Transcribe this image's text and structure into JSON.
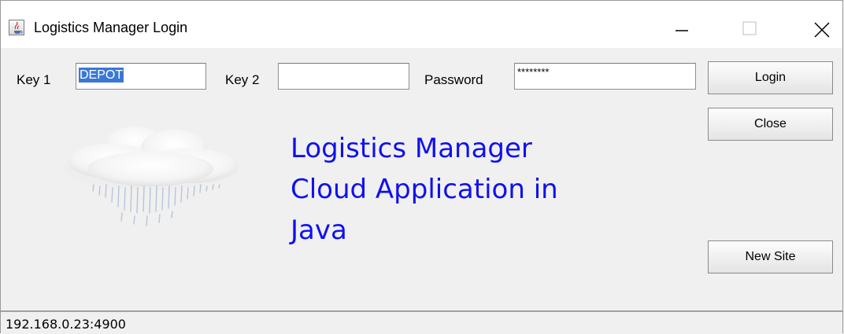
{
  "window": {
    "title": "Logistics Manager Login",
    "app_icon": "java-cup-icon",
    "controls": {
      "minimize": "minimize-icon",
      "maximize": "maximize-icon",
      "close": "close-icon"
    }
  },
  "form": {
    "key1_label": "Key 1",
    "key1_value": "DEPOT",
    "key2_label": "Key 2",
    "key2_value": "",
    "password_label": "Password",
    "password_value": "********"
  },
  "buttons": {
    "login": "Login",
    "close": "Close",
    "new_site": "New Site"
  },
  "banner": {
    "line1": "Logistics Manager",
    "line2": "Cloud Application in",
    "line3": "Java",
    "image": "rain-cloud-icon",
    "text_color": "#1010f0"
  },
  "status": {
    "server_address": "192.168.0.23:4900"
  },
  "colors": {
    "selection": "#3a78d4",
    "background": "#f0f0f0"
  }
}
